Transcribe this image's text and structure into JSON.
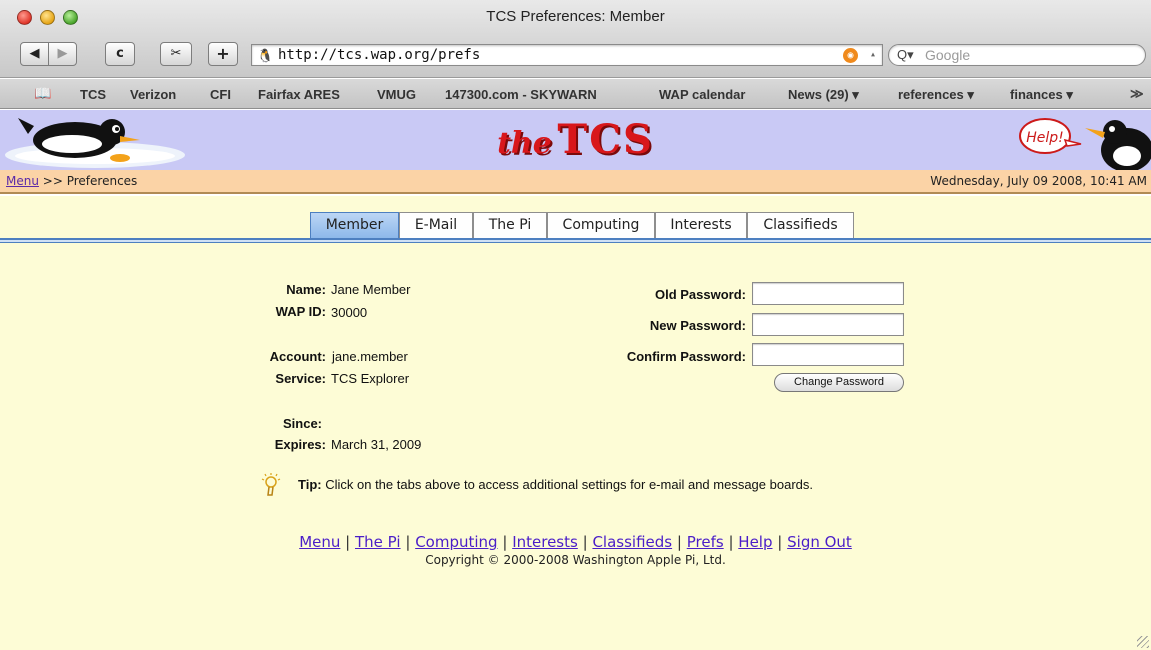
{
  "window": {
    "title": "TCS Preferences: Member"
  },
  "toolbar": {
    "back_icon": "◀",
    "forward_icon": "▶",
    "reload_icon": "c",
    "snapback_icon": "✂",
    "add_icon": "+",
    "url": "http://tcs.wap.org/prefs",
    "search_placeholder": "Google",
    "search_icon": "Q▾"
  },
  "bookmarks": [
    {
      "label": "TCS"
    },
    {
      "label": "Verizon"
    },
    {
      "label": "CFI"
    },
    {
      "label": "Fairfax ARES"
    },
    {
      "label": "VMUG"
    },
    {
      "label": "147300.com - SKYWARN"
    },
    {
      "label": "WAP calendar"
    },
    {
      "label": "News (29) ▾"
    },
    {
      "label": "references ▾"
    },
    {
      "label": "finances ▾"
    }
  ],
  "header": {
    "logo_the": "the",
    "logo_tcs": "TCS",
    "help_label": "Help!"
  },
  "breadcrumb": {
    "menu_link": "Menu",
    "separator": ">>",
    "current": "Preferences"
  },
  "datetime": "Wednesday, July 09 2008, 10:41 AM",
  "tabs": [
    {
      "label": "Member",
      "active": true
    },
    {
      "label": "E-Mail"
    },
    {
      "label": "The Pi"
    },
    {
      "label": "Computing"
    },
    {
      "label": "Interests"
    },
    {
      "label": "Classifieds"
    }
  ],
  "member": {
    "name_label": "Name:",
    "name": "Jane Member",
    "wapid_label": "WAP ID:",
    "wapid": "30000",
    "account_label": "Account:",
    "account": "jane.member",
    "service_label": "Service:",
    "service": "TCS Explorer",
    "since_label": "Since:",
    "since": "",
    "expires_label": "Expires:",
    "expires": "March 31, 2009"
  },
  "password": {
    "old_label": "Old Password:",
    "new_label": "New Password:",
    "confirm_label": "Confirm Password:",
    "button": "Change Password"
  },
  "tip": {
    "label": "Tip:",
    "text": "Click on the tabs above to access additional settings for e-mail and message boards."
  },
  "footer": {
    "links": [
      "Menu",
      "The Pi",
      "Computing",
      "Interests",
      "Classifieds",
      "Prefs",
      "Help",
      "Sign Out"
    ],
    "separator": "|",
    "copyright": "Copyright © 2000-2008 Washington Apple Pi, Ltd."
  },
  "colors": {
    "header_bg": "#c9c9f5",
    "crumb_bg": "#fbd3a6",
    "content_bg": "#fdfcd6",
    "link": "#4a1ec8",
    "logo_red": "#d8171b"
  }
}
